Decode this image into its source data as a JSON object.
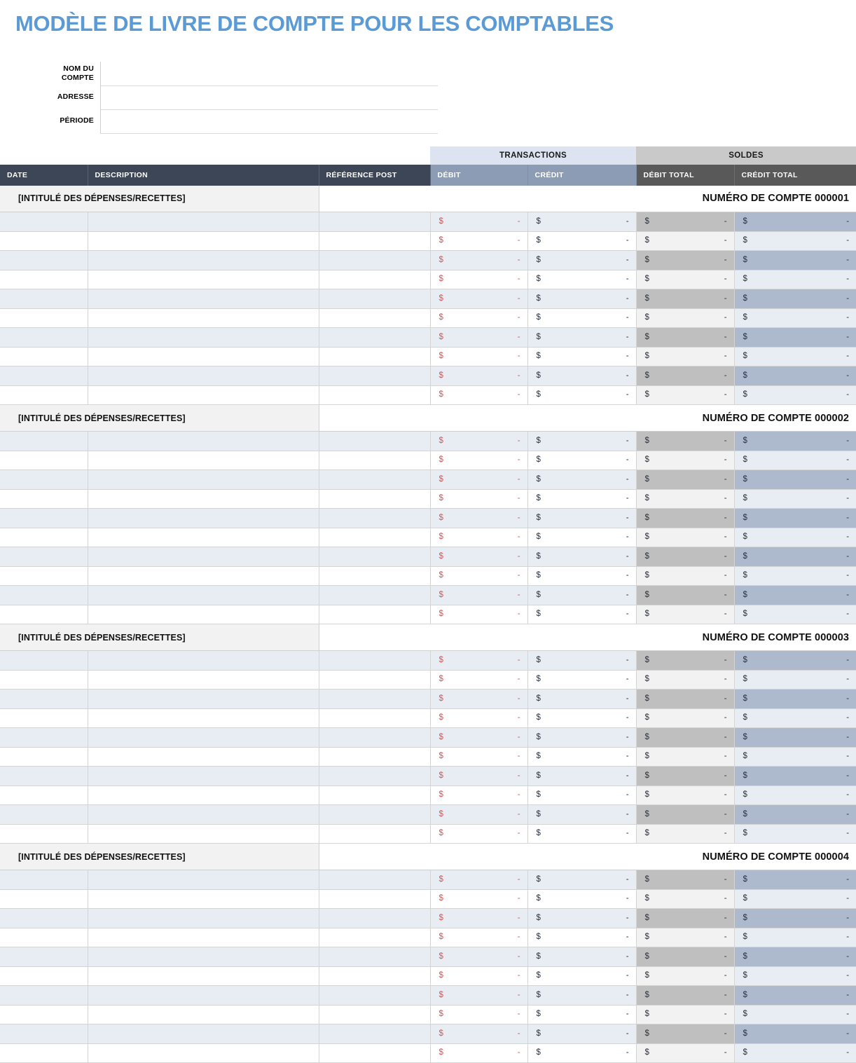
{
  "document": {
    "title": "MODÈLE DE LIVRE DE COMPTE POUR LES COMPTABLES",
    "title_color": "#5b9bd5"
  },
  "meta_form": {
    "fields": [
      {
        "label": "NOM DU COMPTE",
        "value": "",
        "placeholder": ""
      },
      {
        "label": "ADRESSE",
        "value": "",
        "placeholder": ""
      },
      {
        "label": "PÉRIODE",
        "value": "",
        "placeholder": ""
      }
    ]
  },
  "table": {
    "group_headers": [
      {
        "label": "",
        "span": 3,
        "color": "#ffffff"
      },
      {
        "label": "TRANSACTIONS",
        "span": 2,
        "color": "#dde3f0"
      },
      {
        "label": "SOLDES",
        "span": 2,
        "color": "#c9c9c9"
      }
    ],
    "columns": [
      {
        "key": "date",
        "label": "DATE",
        "style": "dark"
      },
      {
        "key": "description",
        "label": "DESCRIPTION",
        "style": "dark"
      },
      {
        "key": "ref",
        "label": "RÉFÉRENCE POST",
        "style": "dark"
      },
      {
        "key": "debit",
        "label": "DÉBIT",
        "style": "blue"
      },
      {
        "key": "credit",
        "label": "CRÉDIT",
        "style": "blue"
      },
      {
        "key": "debit_total",
        "label": "DÉBIT TOTAL",
        "style": "gray"
      },
      {
        "key": "credit_total",
        "label": "CRÉDIT TOTAL",
        "style": "gray"
      }
    ],
    "currency_symbol": "$",
    "empty_value": "-",
    "sections": [
      {
        "title": "[INTITULÉ DES DÉPENSES/RECETTES]",
        "account_number": "NUMÉRO DE COMPTE 000001",
        "row_count": 10
      },
      {
        "title": "[INTITULÉ DES DÉPENSES/RECETTES]",
        "account_number": "NUMÉRO DE COMPTE 000002",
        "row_count": 10
      },
      {
        "title": "[INTITULÉ DES DÉPENSES/RECETTES]",
        "account_number": "NUMÉRO DE COMPTE 000003",
        "row_count": 10
      },
      {
        "title": "[INTITULÉ DES DÉPENSES/RECETTES]",
        "account_number": "NUMÉRO DE COMPTE 000004",
        "row_count": 10
      }
    ]
  },
  "colors": {
    "header_dark": "#3c4657",
    "header_blue": "#8c9cb4",
    "header_gray": "#595959",
    "transactions_group": "#dde3f0",
    "soldes_group": "#c9c9c9",
    "row_odd": "#e8edf3",
    "row_even": "#ffffff",
    "debit_total_odd": "#bfbfbf",
    "credit_total_odd": "#adb9cc",
    "debit_text": "#e05252"
  }
}
